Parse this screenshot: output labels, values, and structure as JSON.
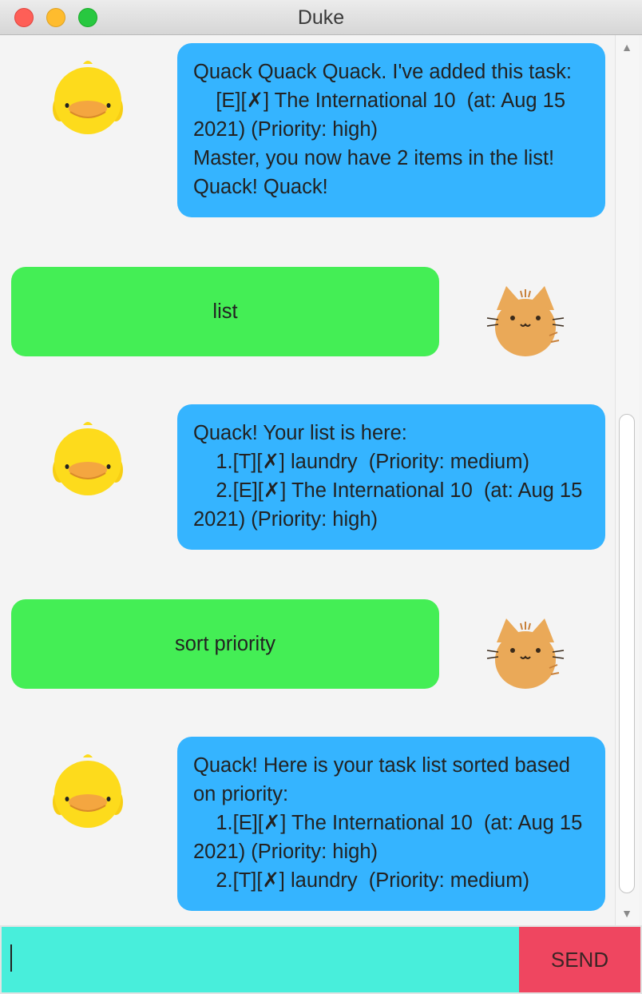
{
  "window": {
    "title": "Duke"
  },
  "colors": {
    "duke_bubble": "#35b4ff",
    "user_bubble": "#44ee55",
    "input_bg": "#48eedb",
    "send_bg": "#ef4660"
  },
  "messages": [
    {
      "sender": "duke",
      "avatar": "duck-icon",
      "text": "Quack Quack Quack. I've added this task:\n    [E][✗] The International 10  (at: Aug 15 2021) (Priority: high)\nMaster, you now have 2 items in the list!\nQuack! Quack!"
    },
    {
      "sender": "user",
      "avatar": "cat-icon",
      "text": "list"
    },
    {
      "sender": "duke",
      "avatar": "duck-icon",
      "text": "Quack! Your list is here:\n    1.[T][✗] laundry  (Priority: medium)\n    2.[E][✗] The International 10  (at: Aug 15 2021) (Priority: high)"
    },
    {
      "sender": "user",
      "avatar": "cat-icon",
      "text": "sort priority"
    },
    {
      "sender": "duke",
      "avatar": "duck-icon",
      "text": "Quack! Here is your task list sorted based on priority:\n    1.[E][✗] The International 10  (at: Aug 15 2021) (Priority: high)\n    2.[T][✗] laundry  (Priority: medium)"
    }
  ],
  "input": {
    "value": "",
    "placeholder": ""
  },
  "send_button": {
    "label": "SEND"
  },
  "scrollbar": {
    "up_icon": "chevron-up-icon",
    "down_icon": "chevron-down-icon"
  }
}
